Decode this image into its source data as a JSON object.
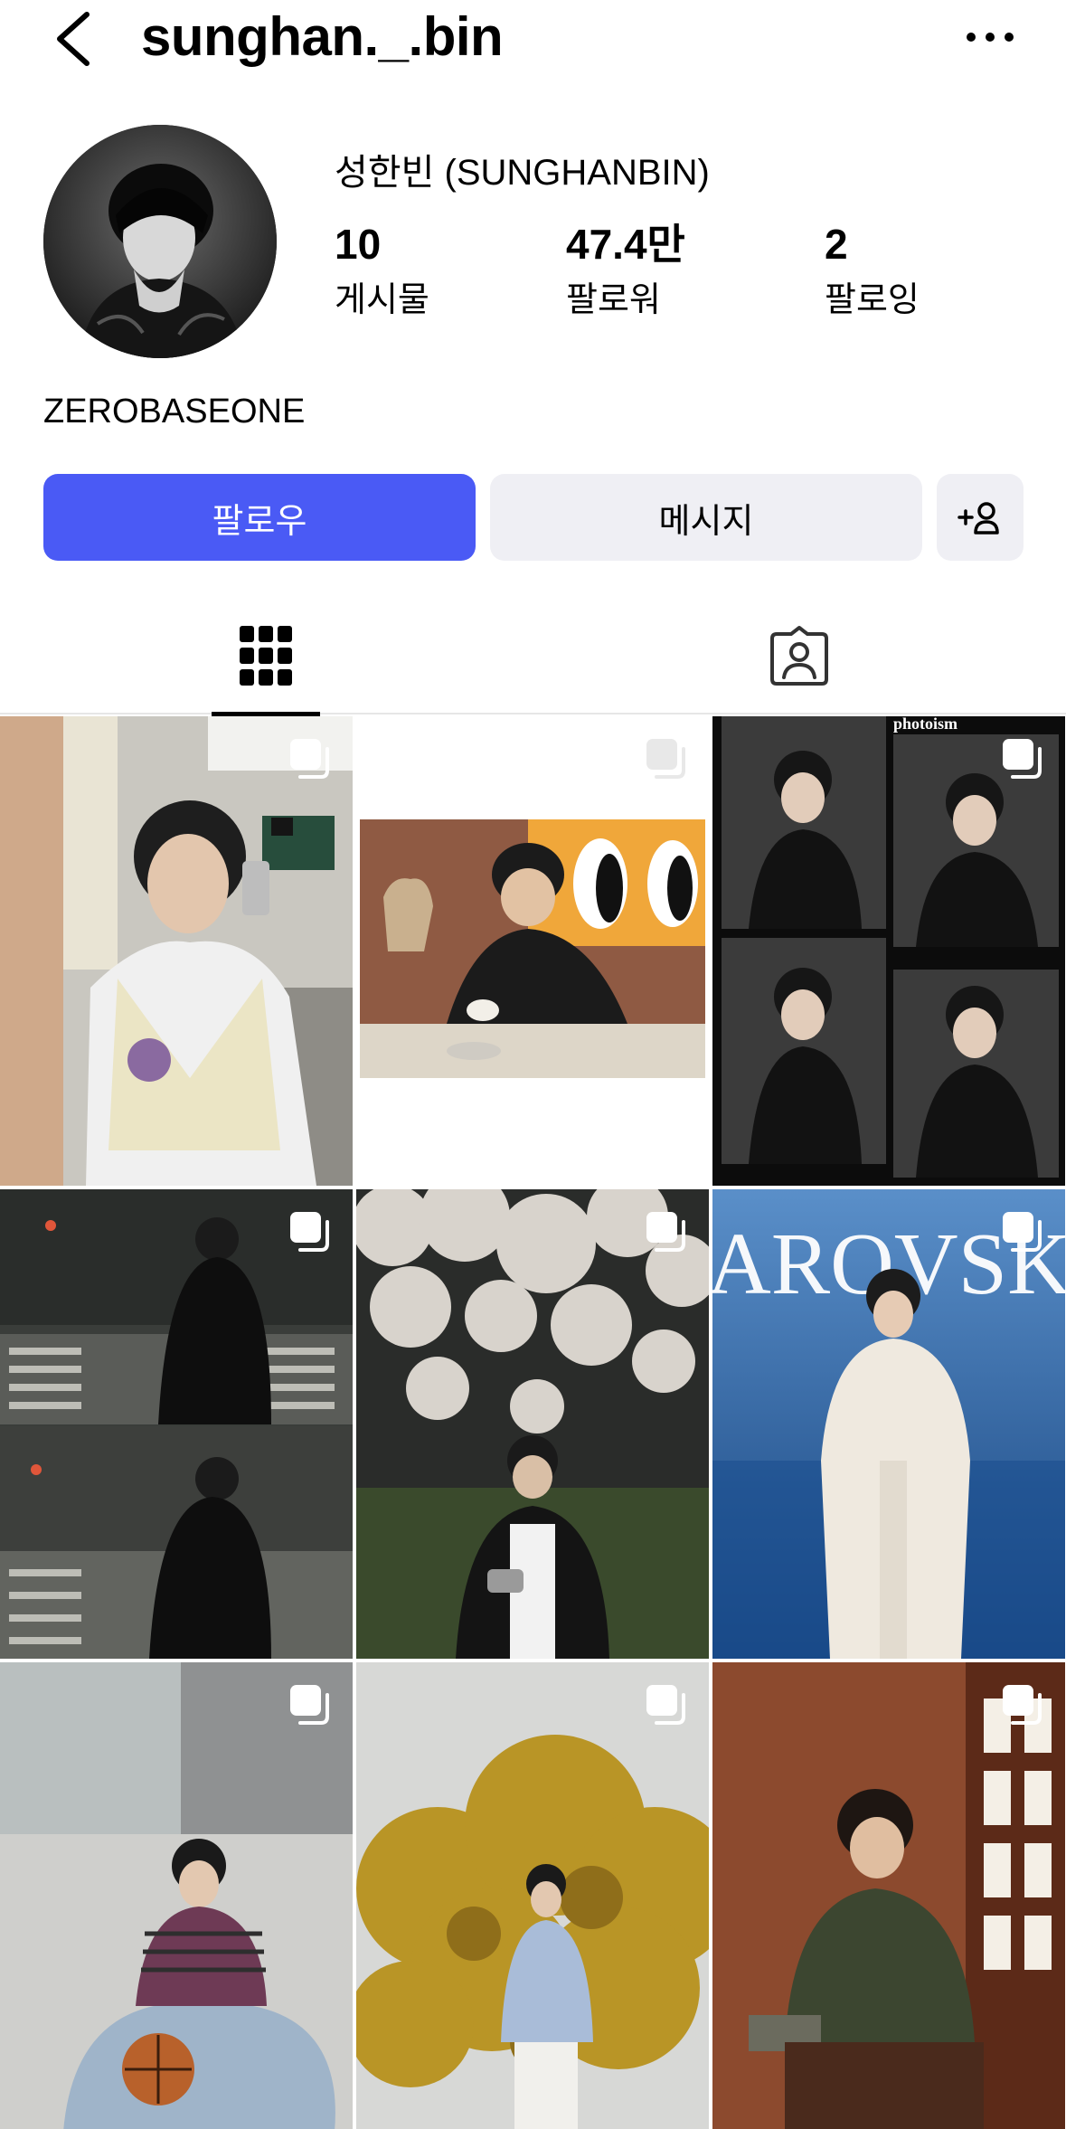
{
  "header": {
    "username": "sunghan._.bin",
    "back_icon": "chevron-left-icon",
    "more_icon": "ellipsis-icon"
  },
  "profile": {
    "display_name": "성한빈 (SUNGHANBIN)",
    "bio": "ZEROBASEONE",
    "stats": [
      {
        "number": "10",
        "label": "게시물"
      },
      {
        "number": "47.4만",
        "label": "팔로워"
      },
      {
        "number": "2",
        "label": "팔로잉"
      }
    ]
  },
  "actions": {
    "follow_label": "팔로우",
    "message_label": "메시지",
    "add_user_icon": "add-person-icon"
  },
  "tabs": [
    {
      "name": "posts",
      "icon": "grid-icon",
      "selected": true
    },
    {
      "name": "tagged",
      "icon": "tagged-person-icon",
      "selected": false
    }
  ],
  "posts": [
    {
      "photo_text": "",
      "multi": true
    },
    {
      "photo_text": "",
      "multi": true
    },
    {
      "photo_text": "photoism",
      "multi": true
    },
    {
      "photo_text": "",
      "multi": true
    },
    {
      "photo_text": "",
      "multi": true
    },
    {
      "photo_text": "AROVSK",
      "multi": true
    },
    {
      "photo_text": "",
      "multi": true
    },
    {
      "photo_text": "",
      "multi": true
    },
    {
      "photo_text": "",
      "multi": true
    }
  ],
  "colors": {
    "accent": "#4a5af5",
    "button_secondary": "#efeff4"
  }
}
